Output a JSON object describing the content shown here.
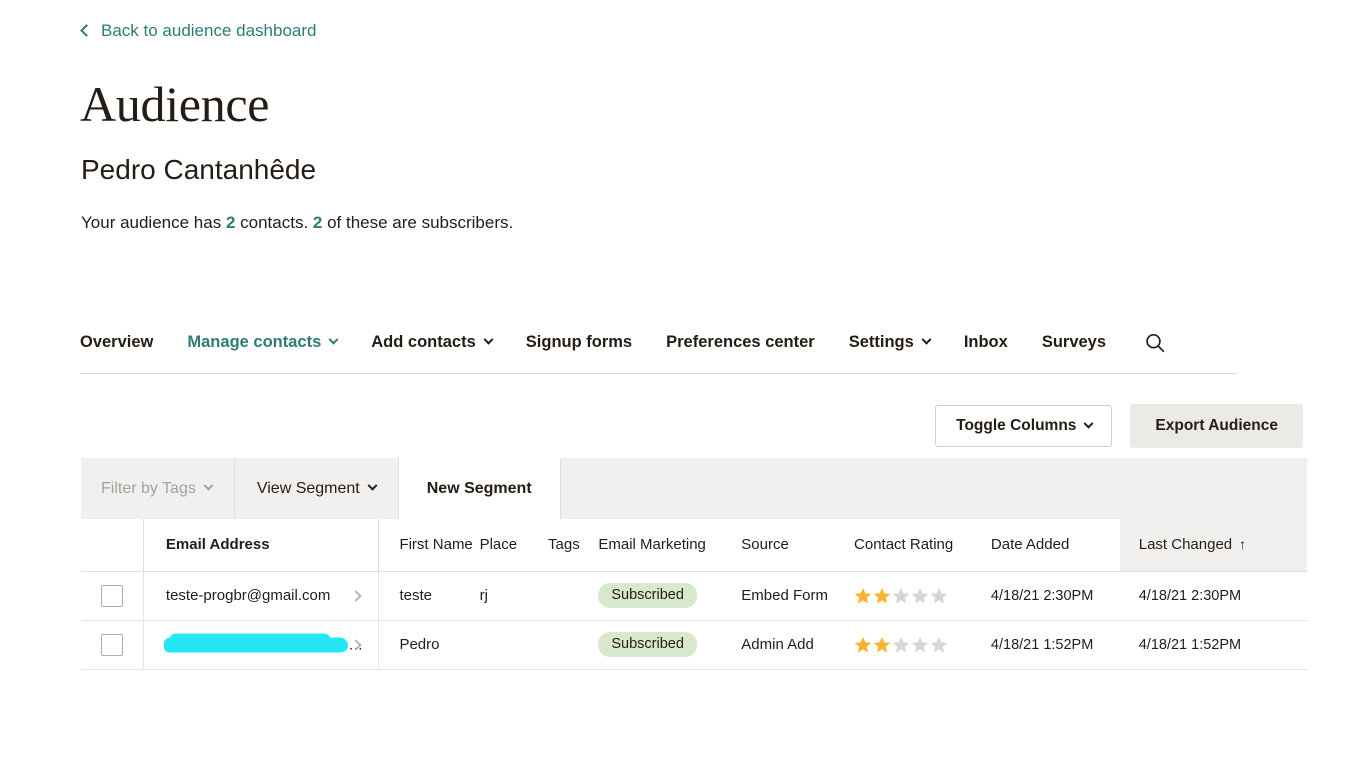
{
  "back_link": {
    "label": "Back to audience dashboard",
    "icon": "chevron-left-icon"
  },
  "header": {
    "title": "Audience",
    "audience_name": "Pedro Cantanhêde",
    "summary_prefix": "Your audience has ",
    "summary_contacts_count": "2",
    "summary_middle": " contacts. ",
    "summary_subscribers_count": "2",
    "summary_suffix": " of these are subscribers.",
    "accent_color": "#2d7d76"
  },
  "nav": {
    "items": [
      {
        "label": "Overview",
        "has_caret": false,
        "active": false
      },
      {
        "label": "Manage contacts",
        "has_caret": true,
        "active": true
      },
      {
        "label": "Add contacts",
        "has_caret": true,
        "active": false
      },
      {
        "label": "Signup forms",
        "has_caret": false,
        "active": false
      },
      {
        "label": "Preferences center",
        "has_caret": false,
        "active": false
      },
      {
        "label": "Settings",
        "has_caret": true,
        "active": false
      },
      {
        "label": "Inbox",
        "has_caret": false,
        "active": false
      },
      {
        "label": "Surveys",
        "has_caret": false,
        "active": false
      }
    ],
    "search_icon": "search-icon"
  },
  "actions": {
    "toggle_columns_label": "Toggle Columns",
    "export_audience_label": "Export Audience"
  },
  "filter_bar": {
    "filter_by_tags_label": "Filter by Tags",
    "view_segment_label": "View Segment",
    "new_segment_label": "New Segment"
  },
  "table": {
    "columns": {
      "email": "Email Address",
      "first_name": "First Name",
      "place": "Place",
      "tags": "Tags",
      "email_marketing": "Email Marketing",
      "source": "Source",
      "contact_rating": "Contact Rating",
      "date_added": "Date Added",
      "last_changed": "Last Changed"
    },
    "sort": {
      "column": "Last Changed",
      "direction": "asc",
      "arrow": "↑"
    },
    "rows": [
      {
        "email": "teste-progbr@gmail.com",
        "redacted": false,
        "first_name": "teste",
        "place": "rj",
        "tags": "",
        "email_marketing": "Subscribed",
        "source": "Embed Form",
        "rating": 2,
        "rating_max": 5,
        "date_added": "4/18/21 2:30PM",
        "last_changed": "4/18/21 2:30PM"
      },
      {
        "email": "",
        "redacted": true,
        "redacted_suffix": "...",
        "first_name": "Pedro",
        "place": "",
        "tags": "",
        "email_marketing": "Subscribed",
        "source": "Admin Add",
        "rating": 2,
        "rating_max": 5,
        "date_added": "4/18/21 1:52PM",
        "last_changed": "4/18/21 1:52PM"
      }
    ]
  },
  "colors": {
    "teal": "#2d7d76",
    "pill_green_bg": "#d7e9cd",
    "star_filled": "#f9b330",
    "star_empty": "#d8d6d3",
    "redaction_cyan": "#23e7f5",
    "filter_bar_bg": "#f1f0ee",
    "export_btn_bg": "#eceae7"
  }
}
